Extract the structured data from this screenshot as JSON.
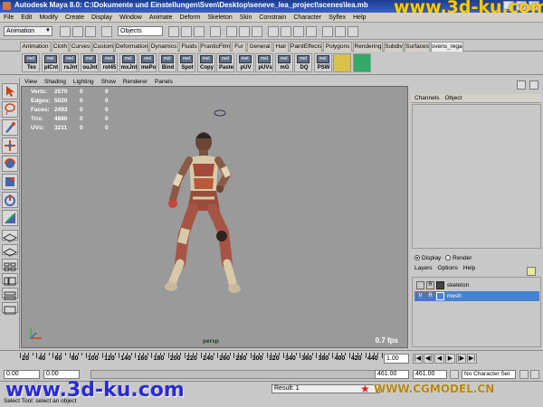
{
  "window": {
    "title": "Autodesk Maya 8.0: C:\\Dokumente und Einstellungen\\Sven\\Desktop\\seneve_lea_project\\scenes\\lea.mb",
    "controls": [
      "_",
      "□",
      "x"
    ]
  },
  "watermarks": {
    "top": "www.3d-ku.com",
    "bottom_left": "www.3d-ku.com",
    "bottom_right": "WWW.CGMODEL.CN"
  },
  "menubar": [
    "File",
    "Edit",
    "Modify",
    "Create",
    "Display",
    "Window",
    "Animate",
    "Deform",
    "Skeleton",
    "Skin",
    "Constrain",
    "Character",
    "Syflex",
    "Help"
  ],
  "statusline": {
    "mode": "Animation",
    "objects_field": "Objects"
  },
  "shelf_tabs": [
    "Animation",
    "Cloth",
    "Curves",
    "Custom",
    "Deformation",
    "Dynamics",
    "Fluids",
    "FranticFilms",
    "Fur",
    "General",
    "Hair",
    "PaintEffects",
    "Polygons",
    "Rendering",
    "Subdivs",
    "Surfaces",
    "svens_regal"
  ],
  "active_shelf_tab": "svens_regal",
  "shelf_buttons": [
    {
      "icon": "mel",
      "label": "Tex"
    },
    {
      "icon": "mel",
      "label": "pICnt"
    },
    {
      "icon": "mel",
      "label": "rsJnt"
    },
    {
      "icon": "mel",
      "label": "ouJnt"
    },
    {
      "icon": "mel",
      "label": "rot45"
    },
    {
      "icon": "mel",
      "label": "mxJnt"
    },
    {
      "icon": "mel",
      "label": "mePo"
    },
    {
      "icon": "mel",
      "label": "Bind"
    },
    {
      "icon": "mel",
      "label": "Spot"
    },
    {
      "icon": "mel",
      "label": "Copy"
    },
    {
      "icon": "mel",
      "label": "Paste"
    },
    {
      "icon": "mel",
      "label": "pUV"
    },
    {
      "icon": "mel",
      "label": "pUVs"
    },
    {
      "icon": "mel",
      "label": "mG"
    },
    {
      "icon": "mel",
      "label": "DQ"
    },
    {
      "icon": "mel",
      "label": "PSW"
    }
  ],
  "viewport": {
    "menu": [
      "View",
      "Shading",
      "Lighting",
      "Show",
      "Renderer",
      "Panels"
    ],
    "hud": [
      {
        "label": "Verts:",
        "values": [
          "2570",
          "0",
          "0"
        ]
      },
      {
        "label": "Edges:",
        "values": [
          "5020",
          "0",
          "0"
        ]
      },
      {
        "label": "Faces:",
        "values": [
          "2493",
          "0",
          "0"
        ]
      },
      {
        "label": "Tris:",
        "values": [
          "4880",
          "0",
          "0"
        ]
      },
      {
        "label": "UVs:",
        "values": [
          "3211",
          "0",
          "0"
        ]
      }
    ],
    "camera": "persp",
    "fps": "0.7 fps"
  },
  "channel_box": {
    "menu": [
      "Channels",
      "Object"
    ]
  },
  "layer_editor": {
    "display_options": [
      "Display",
      "Render"
    ],
    "selected_option": "Display",
    "menu": [
      "Layers",
      "Options",
      "Help"
    ],
    "layers": [
      {
        "visible": "",
        "reference": "R",
        "name": "skeleton",
        "selected": false
      },
      {
        "visible": "V",
        "reference": "R",
        "name": "mesh",
        "selected": true
      }
    ]
  },
  "time_slider": {
    "ticks": [
      "20",
      "40",
      "60",
      "80",
      "100",
      "120",
      "140",
      "160",
      "180",
      "200",
      "220",
      "240",
      "260",
      "280",
      "300",
      "320",
      "340",
      "360",
      "380",
      "400",
      "420",
      "440"
    ],
    "current": "1.00",
    "playback_buttons": [
      "|◀",
      "◀|",
      "◀",
      "▶",
      "|▶",
      "▶|"
    ]
  },
  "range_slider": {
    "start": "0.00",
    "inner_start": "0.00",
    "inner_end": "461.00",
    "end": "461.00",
    "character_set": "No Character Set"
  },
  "command_line": {
    "result": "Result: 1"
  },
  "help_line": "Select Tool: select an object"
}
